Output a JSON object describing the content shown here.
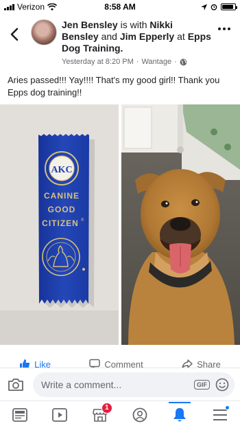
{
  "status_bar": {
    "carrier": "Verizon",
    "time": "8:58 AM",
    "battery_level": 0.9
  },
  "post": {
    "author": "Jen Bensley",
    "is_with": "is with",
    "tag1": "Nikki Bensley",
    "and": "and",
    "tag2": "Jim Epperly",
    "at": "at",
    "place": "Epps Dog Training.",
    "timestamp": "Yesterday at 8:20 PM",
    "separator": "·",
    "location": "Wantage",
    "privacy_icon": "globe-icon",
    "text": "Aries passed!!! Yay!!!! That's my good girl!! Thank you Epps dog training!!"
  },
  "ribbon": {
    "seal_text": "AKC",
    "line1": "CANINE",
    "line2": "GOOD",
    "line3": "CITIZEN",
    "reg": "®",
    "ribbon_color": "#1f3fae",
    "gold_color": "#d8c07a"
  },
  "actions": {
    "like": "Like",
    "comment": "Comment",
    "share": "Share"
  },
  "composer": {
    "placeholder": "Write a comment...",
    "gif_label": "GIF"
  },
  "bottom_nav": {
    "marketplace_badge": "1",
    "icons": [
      "news-feed-icon",
      "watch-icon",
      "marketplace-icon",
      "profile-icon",
      "notifications-icon",
      "menu-icon"
    ]
  },
  "colors": {
    "accent": "#1877f2",
    "badge": "#e41e3f",
    "secondary_text": "#65676b"
  }
}
